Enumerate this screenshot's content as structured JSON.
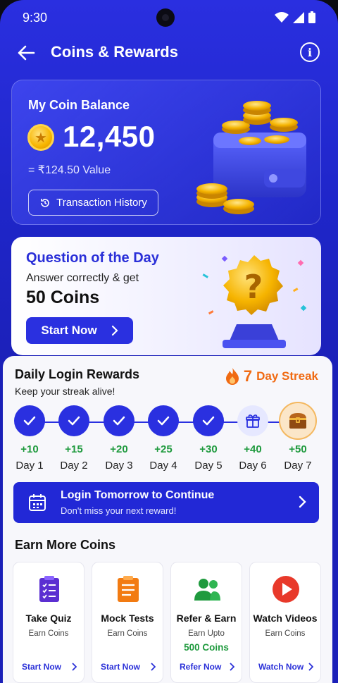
{
  "status_bar": {
    "time": "9:30"
  },
  "header": {
    "title": "Coins & Rewards",
    "info_label": "i"
  },
  "balance": {
    "label": "My Coin Balance",
    "value": "12,450",
    "rupee_value": "= ₹124.50 Value",
    "history_button": "Transaction History"
  },
  "question": {
    "title": "Question of the Day",
    "subtitle": "Answer correctly & get",
    "reward": "50 Coins",
    "button": "Start Now"
  },
  "daily_login": {
    "title": "Daily Login Rewards",
    "subtitle": "Keep your streak alive!",
    "streak_count": "7",
    "streak_label": "Day Streak",
    "days": [
      {
        "points": "+10",
        "label": "Day 1",
        "state": "done"
      },
      {
        "points": "+15",
        "label": "Day 2",
        "state": "done"
      },
      {
        "points": "+20",
        "label": "Day 3",
        "state": "done"
      },
      {
        "points": "+25",
        "label": "Day 4",
        "state": "done"
      },
      {
        "points": "+30",
        "label": "Day 5",
        "state": "done"
      },
      {
        "points": "+40",
        "label": "Day 6",
        "state": "gift"
      },
      {
        "points": "+50",
        "label": "Day 7",
        "state": "chest"
      }
    ],
    "banner_title": "Login Tomorrow to Continue",
    "banner_subtitle": "Don't miss your next reward!"
  },
  "earn_more": {
    "title": "Earn More Coins",
    "cards": [
      {
        "name": "Take Quiz",
        "sub": "Earn Coins",
        "highlight": "",
        "cta": "Start Now",
        "icon": "quiz-icon"
      },
      {
        "name": "Mock Tests",
        "sub": "Earn Coins",
        "highlight": "",
        "cta": "Start Now",
        "icon": "mock-test-icon"
      },
      {
        "name": "Refer & Earn",
        "sub": "Earn Upto",
        "highlight": "500 Coins",
        "cta": "Refer Now",
        "icon": "refer-icon"
      },
      {
        "name": "Watch Videos",
        "sub": "Earn Coins",
        "highlight": "",
        "cta": "Watch Now",
        "icon": "play-video-icon"
      }
    ]
  },
  "colors": {
    "primary": "#2a30e0",
    "streak_orange": "#f06a12",
    "success_green": "#1f9a3e",
    "gold": "#f7b500"
  }
}
